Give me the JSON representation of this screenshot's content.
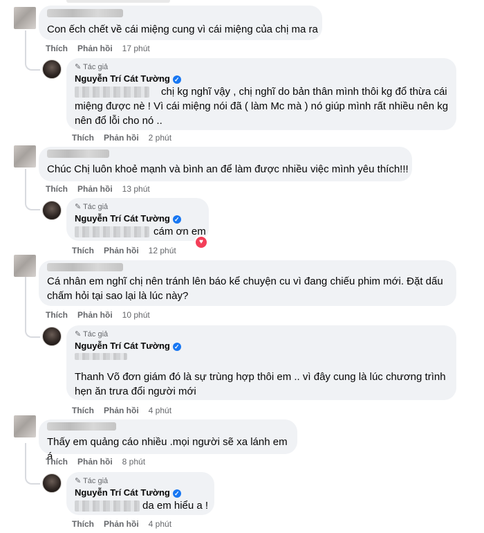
{
  "common": {
    "like": "Thích",
    "reply": "Phản hồi",
    "author_badge": "Tác giả",
    "author_name": "Nguyễn Trí Cát Tường"
  },
  "threads": [
    {
      "comment": {
        "text": "Con ếch chết về cái miệng cung vì cái miệng của chị ma ra",
        "time": "17 phút"
      },
      "reply": {
        "text": "chị kg nghĩ vậy , chị nghĩ do bản thân mình thôi kg đổ thừa cái\nmiệng được nè ! Vì cái miệng nói đã ( làm Mc mà ) nó giúp mình rất nhiều nên kg\nnên đổ lỗi cho nó ..",
        "time": "2 phút"
      }
    },
    {
      "comment": {
        "text": "Chúc Chị luôn khoẻ mạnh và bình an để làm được nhiều việc mình yêu thích!!!",
        "time": "13 phút"
      },
      "reply": {
        "text": "cám ơn em",
        "time": "12 phút"
      }
    },
    {
      "comment": {
        "text": "Cá nhân em nghĩ chị nên tránh lên báo kể chuyện cu vì đang chiếu phim mới. Đặt dấu\nchấm hỏi tại sao lại là lúc này?",
        "time": "10 phút"
      },
      "reply": {
        "text": "Thanh Võ đơn giám đó là sự trùng hợp thôi em .. vì đây cung là lúc chương trình\nhẹn ăn trưa đổi người mới",
        "time": "4 phút"
      }
    },
    {
      "comment": {
        "text": "Thấy em quảng cáo nhiều .mọi người sẽ xa lánh em á",
        "time": "8 phút"
      },
      "reply": {
        "text": "da em hiểu a !",
        "time": "4 phút"
      }
    }
  ]
}
